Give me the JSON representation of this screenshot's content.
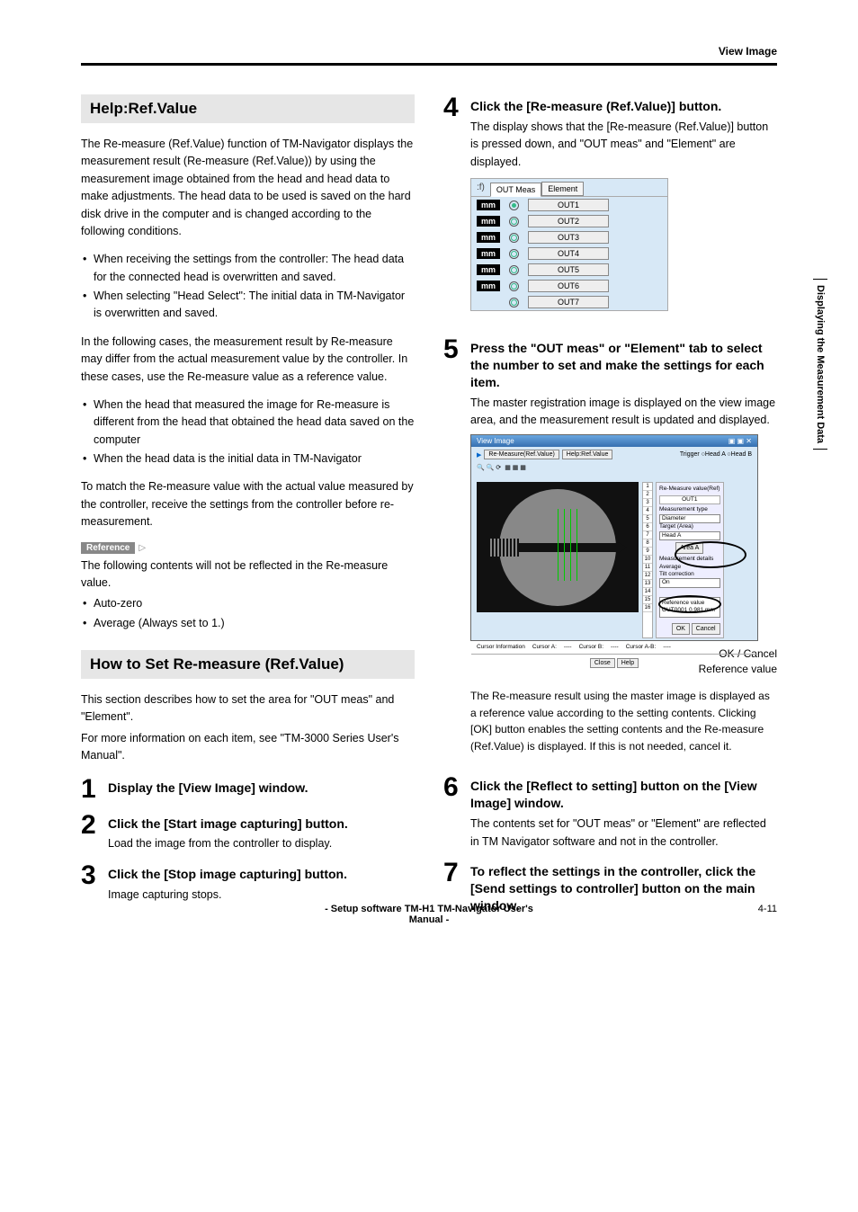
{
  "header": {
    "section": "View Image"
  },
  "side_tab": "Displaying the Measurement Data",
  "left": {
    "h1": "Help:Ref.Value",
    "p1": "The Re-measure (Ref.Value) function of TM-Navigator displays the measurement result (Re-measure (Ref.Value)) by using the measurement image obtained from the head and head data to make adjustments. The head data to be used is saved on the hard disk drive in the computer and is changed according to the following conditions.",
    "b1a": "When receiving the settings from the controller: The head data for the connected head is overwritten and saved.",
    "b1b": "When selecting \"Head Select\": The initial data in TM-Navigator is overwritten and saved.",
    "p2": "In the following cases, the measurement result by Re-measure may differ from the actual measurement value by the controller. In these cases, use the Re-measure value as a reference value.",
    "b2a": "When the head that measured the image for Re-measure is different from the head that obtained the head data saved on the computer",
    "b2b": "When the head data is the initial data in TM-Navigator",
    "p3": "To match the Re-measure value with the actual value measured by the controller, receive the settings from the controller before re-measurement.",
    "ref_label": "Reference",
    "p4": "The following contents will not be reflected in the Re-measure value.",
    "b3a": "Auto-zero",
    "b3b": "Average (Always set to 1.)",
    "h2": "How to Set Re-measure (Ref.Value)",
    "p5": "This section describes how to set the area for \"OUT meas\" and \"Element\".",
    "p6": "For more information on each item, see \"TM-3000 Series User's Manual\".",
    "s1": {
      "n": "1",
      "t": "Display the [View Image] window."
    },
    "s2": {
      "n": "2",
      "t": "Click the [Start image capturing] button.",
      "d": "Load the image from the controller to display."
    },
    "s3": {
      "n": "3",
      "t": "Click the [Stop image capturing] button.",
      "d": "Image capturing stops."
    }
  },
  "right": {
    "s4": {
      "n": "4",
      "t": "Click the [Re-measure (Ref.Value)] button.",
      "d": "The display shows that the [Re-measure (Ref.Value)] button is pressed down, and \"OUT meas\" and \"Element\"  are displayed."
    },
    "fig1": {
      "sf": ":f)",
      "tab1": "OUT Meas",
      "tab2": "Element",
      "mm": "mm",
      "rows": [
        "OUT1",
        "OUT2",
        "OUT3",
        "OUT4",
        "OUT5",
        "OUT6",
        "OUT7"
      ]
    },
    "s5": {
      "n": "5",
      "t": "Press the \"OUT meas\" or \"Element\" tab to select the number to set and make the settings for each item.",
      "d": "The master registration image is displayed on the view image area, and the measurement result is updated and displayed."
    },
    "fig2": {
      "title": "View Image",
      "side_header": "Re-Measure value(Ref)",
      "out_label": "OUT1",
      "l1": "Measurement type",
      "l2": "Diameter",
      "l3": "Target (Area)",
      "l4": "Head A",
      "area_btn": "Area A",
      "l5": "Measurement details",
      "l6": "Average",
      "l7": "Tilt correction",
      "l8": "On",
      "ref_box_t": "Reference value",
      "ref_box_v": "OUT0001   0.981 mm",
      "ok": "OK",
      "cancel": "Cancel",
      "close": "Close",
      "help": "Help",
      "cursor_info": "Cursor Information",
      "ca": "Cursor A:",
      "cb": "Cursor B:",
      "cab": "Cursor A-B:"
    },
    "fig2_cap1": "OK / Cancel",
    "fig2_cap2": "Reference value",
    "p7": "The Re-measure result using the master image is displayed as a reference value according to the setting contents. Clicking [OK] button enables the setting contents and the Re-measure (Ref.Value) is displayed. If this is not needed, cancel it.",
    "s6": {
      "n": "6",
      "t": "Click the [Reflect to setting] button on the [View Image] window.",
      "d": "The contents set for \"OUT meas\" or \"Element\" are reflected in TM Navigator software and not in the controller."
    },
    "s7": {
      "n": "7",
      "t": "To reflect the settings in the controller, click the [Send settings to controller] button on the main window."
    }
  },
  "footer": {
    "center": "- Setup software TM-H1 TM-Navigator User's Manual -",
    "right": "4-11"
  }
}
